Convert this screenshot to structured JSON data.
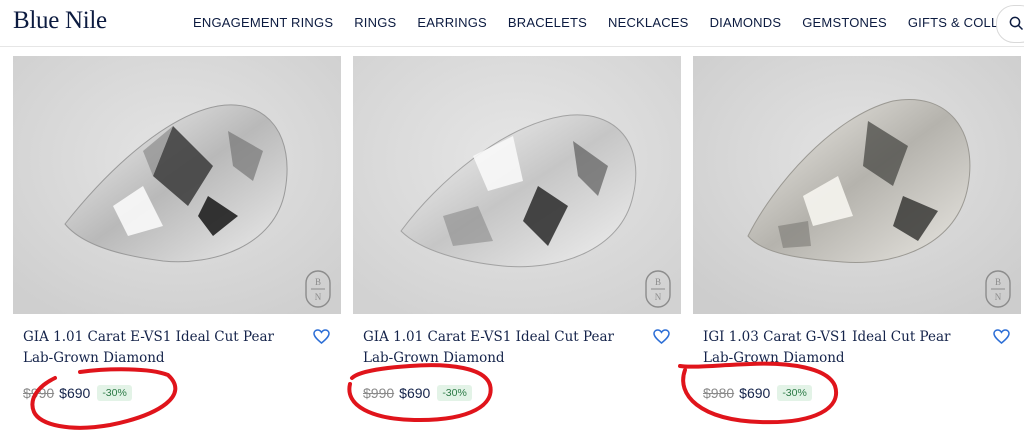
{
  "header": {
    "logo": "Blue Nile",
    "nav": [
      "ENGAGEMENT RINGS",
      "RINGS",
      "EARRINGS",
      "BRACELETS",
      "NECKLACES",
      "DIAMONDS",
      "GEMSTONES",
      "GIFTS & COLLECTIONS"
    ]
  },
  "products": [
    {
      "title": "GIA 1.01 Carat E-VS1 Ideal Cut Pear Lab-Grown Diamond",
      "old_price": "$990",
      "price": "$690",
      "discount": "-30%",
      "monogram_top": "B",
      "monogram_bottom": "N"
    },
    {
      "title": "GIA 1.01 Carat E-VS1 Ideal Cut Pear Lab-Grown Diamond",
      "old_price": "$990",
      "price": "$690",
      "discount": "-30%",
      "monogram_top": "B",
      "monogram_bottom": "N"
    },
    {
      "title": "IGI 1.03 Carat G-VS1 Ideal Cut Pear Lab-Grown Diamond",
      "old_price": "$980",
      "price": "$690",
      "discount": "-30%",
      "monogram_top": "B",
      "monogram_bottom": "N"
    }
  ],
  "colors": {
    "annotation": "#e0141b",
    "brand": "#0c1b40"
  }
}
